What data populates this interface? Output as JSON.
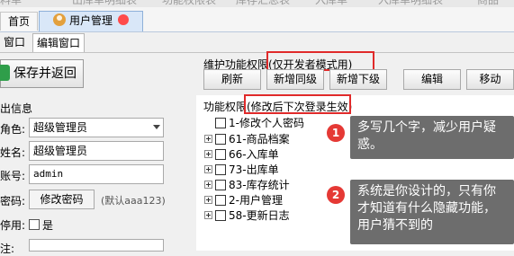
{
  "window_top_ghost": [
    "料单",
    "出库单明细表",
    "功能权限表",
    "库存汇总表",
    "入库单",
    "入库单明细表",
    "商品"
  ],
  "tabs": [
    {
      "label": "首页"
    },
    {
      "label": "用户管理"
    }
  ],
  "subtabs": [
    {
      "label": "窗口"
    },
    {
      "label": "编辑窗口"
    }
  ],
  "save_button": {
    "label": "保存并返回"
  },
  "left_form": {
    "section_title": "出信息",
    "role_label": "角色:",
    "role_value": "超级管理员",
    "name_label": "姓名:",
    "name_value": "超级管理员",
    "account_label": "账号:",
    "account_value": "admin",
    "password_label": "密码:",
    "password_button": "修改密码",
    "password_hint": "(默认aaa123)",
    "disabled_label": "停用:",
    "disabled_option": "是",
    "extra_label": "注:"
  },
  "toolbar": {
    "title": "维护功能权限(仅开发者模式用)",
    "buttons": [
      "刷新",
      "新增同级",
      "新增下级",
      "编辑",
      "移动"
    ]
  },
  "permissions": {
    "title": "功能权限(修改后下次登录生效)",
    "items": [
      {
        "label": "1-修改个人密码"
      },
      {
        "label": "61-商品档案"
      },
      {
        "label": "66-入库单"
      },
      {
        "label": "73-出库单"
      },
      {
        "label": "83-库存统计"
      },
      {
        "label": "2-用户管理"
      },
      {
        "label": "58-更新日志"
      }
    ]
  },
  "annotations": [
    {
      "number": "1",
      "text": "多写几个字，减少用户疑惑。"
    },
    {
      "number": "2",
      "text": "系统是你设计的，只有你才知道有什么隐藏功能，用户猜不到的"
    }
  ],
  "colors": {
    "highlight": "#e02a2a",
    "callout_bg": "#6d6d6d",
    "badge": "#e53935",
    "active_tab": "#d9e7f8"
  }
}
